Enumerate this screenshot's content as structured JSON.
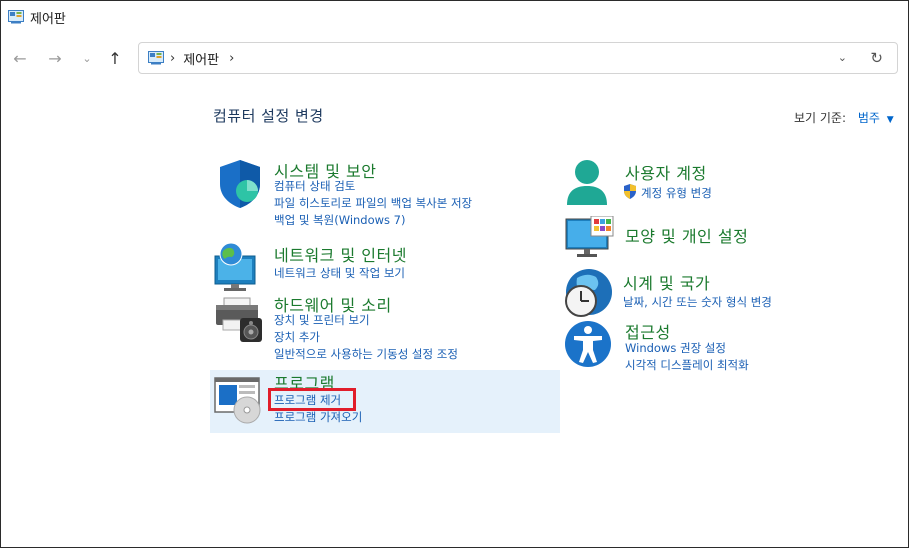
{
  "window": {
    "title": "제어판"
  },
  "address": {
    "crumb": "제어판",
    "separator": "›"
  },
  "header": {
    "heading": "컴퓨터 설정 변경",
    "view_by_label": "보기 기준:",
    "view_by_value": "범주"
  },
  "categories": {
    "system": {
      "title": "시스템 및 보안",
      "links": [
        "컴퓨터 상태 검토",
        "파일 히스토리로 파일의 백업 복사본 저장",
        "백업 및 복원(Windows 7)"
      ]
    },
    "network": {
      "title": "네트워크 및 인터넷",
      "links": [
        "네트워크 상태 및 작업 보기"
      ]
    },
    "hardware": {
      "title": "하드웨어 및 소리",
      "links": [
        "장치 및 프린터 보기",
        "장치 추가",
        "일반적으로 사용하는 기동성 설정 조정"
      ]
    },
    "programs": {
      "title": "프로그램",
      "links": [
        "프로그램 제거",
        "프로그램 가져오기"
      ]
    },
    "users": {
      "title": "사용자 계정",
      "links": [
        "계정 유형 변경"
      ]
    },
    "appearance": {
      "title": "모양 및 개인 설정",
      "links": []
    },
    "clock": {
      "title": "시계 및 국가",
      "links": [
        "날짜, 시간 또는 숫자 형식 변경"
      ]
    },
    "access": {
      "title": "접근성",
      "links": [
        "Windows 권장 설정",
        "시각적 디스플레이 최적화"
      ]
    }
  },
  "colors": {
    "category_title": "#1b7a2e",
    "link": "#1a5fb4",
    "highlight": "#e5f1fb",
    "annotation": "#e11d2a"
  },
  "icons": [
    "control-panel-icon",
    "back-arrow-icon",
    "forward-arrow-icon",
    "recent-chevron-icon",
    "up-arrow-icon",
    "dropdown-chevron-icon",
    "refresh-icon",
    "shield-icon",
    "globe-network-icon",
    "printer-icon",
    "programs-disc-icon",
    "user-icon",
    "monitor-palette-icon",
    "clock-globe-icon",
    "accessibility-icon"
  ]
}
